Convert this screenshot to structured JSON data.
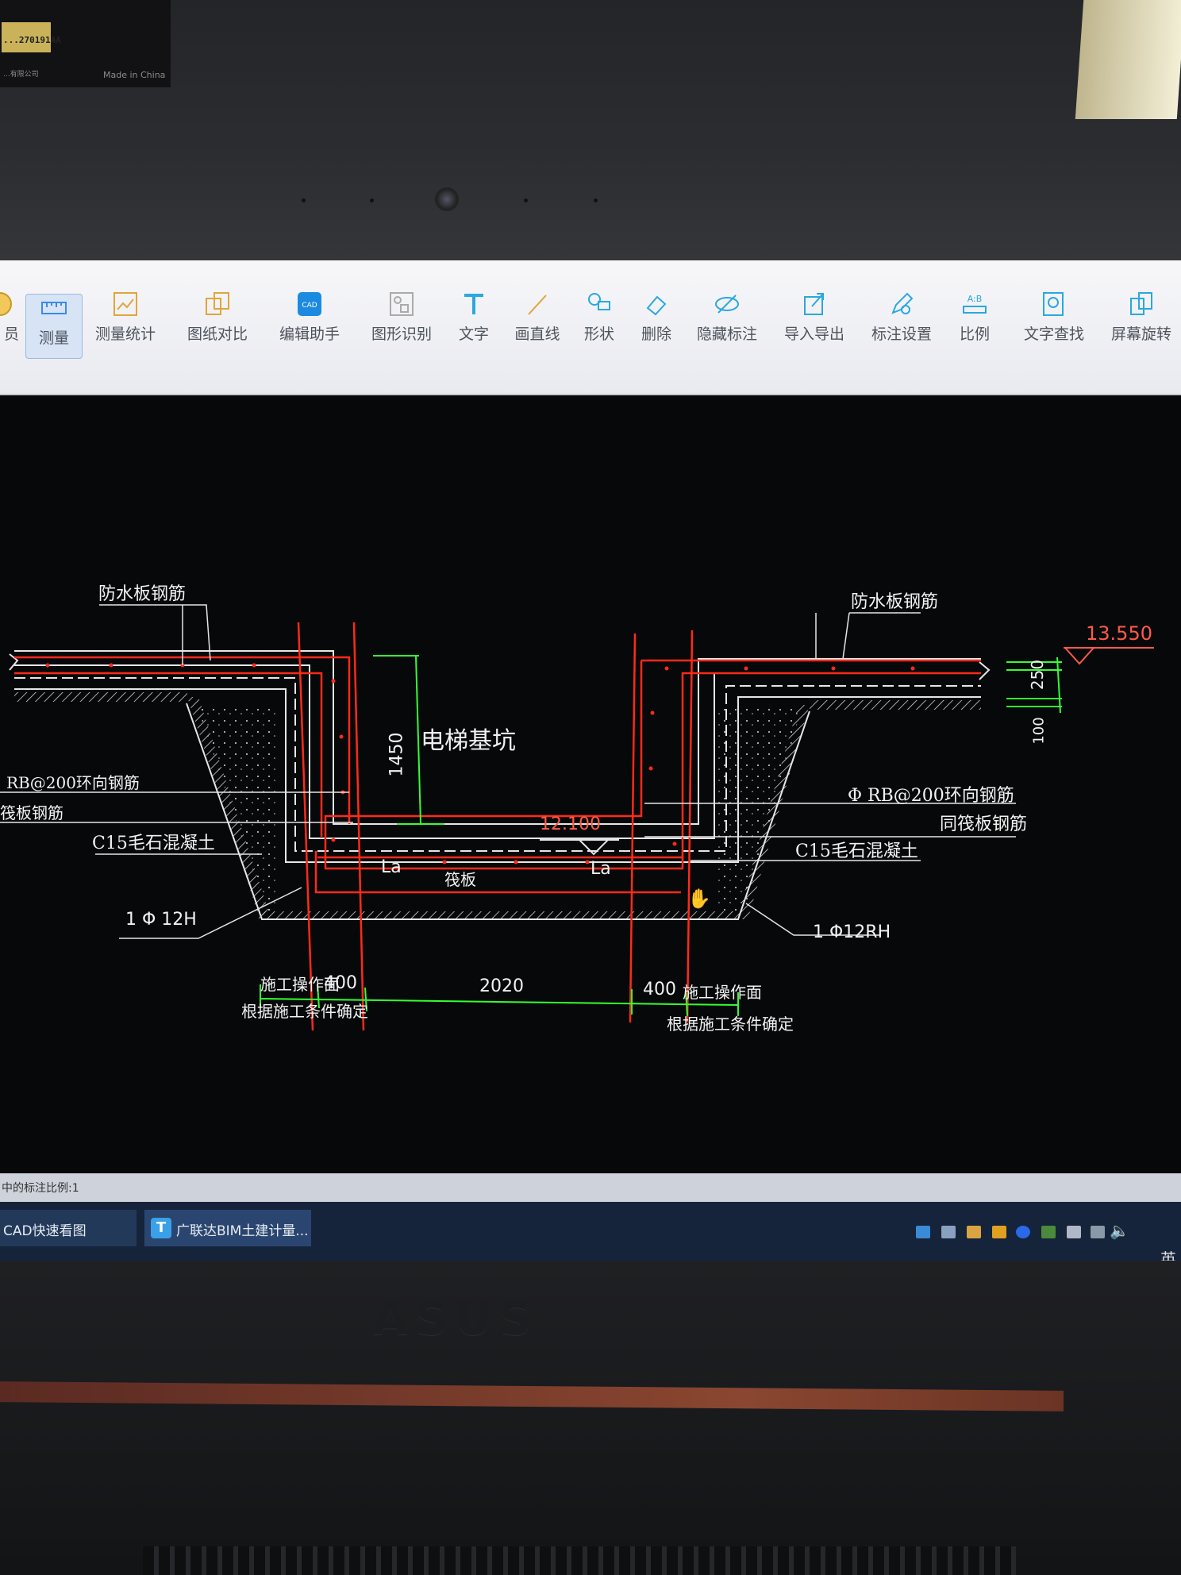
{
  "sticker": {
    "code": "...270191AA",
    "company_text": "...有限公司",
    "made_in": "Made in China"
  },
  "toolbar": {
    "buttons": [
      {
        "label": "员"
      },
      {
        "label": "测量"
      },
      {
        "label": "测量统计"
      },
      {
        "label": "图纸对比"
      },
      {
        "label": "编辑助手"
      },
      {
        "label": "图形识别"
      },
      {
        "label": "文字"
      },
      {
        "label": "画直线"
      },
      {
        "label": "形状"
      },
      {
        "label": "删除"
      },
      {
        "label": "隐藏标注"
      },
      {
        "label": "导入导出"
      },
      {
        "label": "标注设置"
      },
      {
        "label": "比例"
      },
      {
        "label": "文字查找"
      },
      {
        "label": "屏幕旋转"
      }
    ],
    "ratio_icon_text": "A:B",
    "active": "测量"
  },
  "drawing": {
    "title": "电梯基坑",
    "labels": {
      "waterproof_rebar_left": "防水板钢筋",
      "waterproof_rebar_right": "防水板钢筋",
      "ring_rebar_left": "RB@200环向钢筋",
      "ring_rebar_right": "Φ RB@200环向钢筋",
      "raft_rebar_left": "筏板钢筋",
      "raft_rebar_right": "同筏板钢筋",
      "concrete_left": "C15毛石混凝土",
      "concrete_right": "C15毛石混凝土",
      "bar_left": "1 Φ 12H",
      "bar_right": "1  Φ12RH",
      "la_left": "La",
      "la_right": "La",
      "raft": "筏板",
      "work_face_left": "施工操作面",
      "work_face_right": "施工操作面",
      "note_left": "根据施工条件确定",
      "note_right": "根据施工条件确定"
    },
    "elevations": {
      "top": "13.550",
      "bottom": "12.100"
    },
    "dimensions": {
      "pit_depth": "1450",
      "left_work": "400",
      "span": "2020",
      "right_work": "400",
      "slab": "250",
      "cushion": "100"
    },
    "colors": {
      "rebar": "#ff2a1a",
      "line": "#e6e6e6",
      "dim": "#33ff33",
      "elev": "#ff5a4a"
    }
  },
  "status": {
    "text": "中的标注比例:1"
  },
  "taskbar": {
    "items": [
      {
        "label": "CAD快速看图"
      },
      {
        "label": "广联达BIM土建计量..."
      }
    ],
    "ime": "英"
  }
}
